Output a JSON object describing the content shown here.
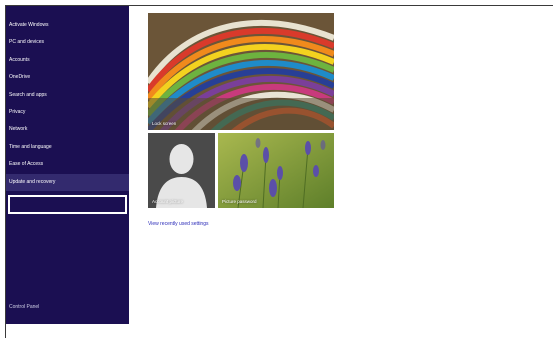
{
  "sidebar": {
    "items": [
      {
        "label": "Activate Windows"
      },
      {
        "label": "PC and devices"
      },
      {
        "label": "Accounts"
      },
      {
        "label": "OneDrive"
      },
      {
        "label": "Search and apps"
      },
      {
        "label": "Privacy"
      },
      {
        "label": "Network"
      },
      {
        "label": "Time and language"
      },
      {
        "label": "Ease of Access"
      },
      {
        "label": "Update and recovery",
        "selected": true
      }
    ],
    "search_value": "",
    "control_panel_label": "Control Panel"
  },
  "tiles": {
    "lock_screen_label": "Lock screen",
    "account_picture_label": "Account picture",
    "picture_password_label": "Picture password"
  },
  "recent_link_label": "View recently used settings",
  "colors": {
    "sidebar_background": "#1b0f52",
    "selected_item_background": "#332a6e",
    "link": "#2b2bb8"
  }
}
